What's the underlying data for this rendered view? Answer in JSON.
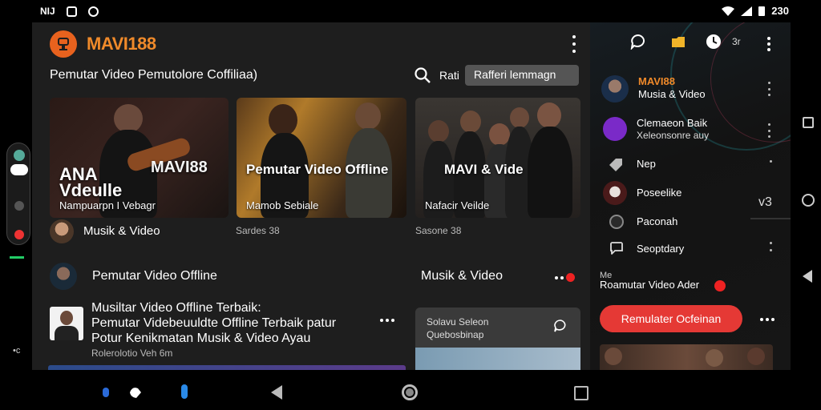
{
  "status_bar": {
    "left_text": "NIJ",
    "time": "230"
  },
  "app": {
    "brand": "MAVI188",
    "subtitle": "Pemutar Video Pemutolore Coffiliaa)",
    "search_label": "Rati",
    "search_value": "Rafferi lemmagn",
    "cards": [
      {
        "overlay": "MAVI88",
        "overlay_left": "ANA Vdeulle",
        "caption": "Nampuarpn I Vebagr"
      },
      {
        "overlay": "Pemutar Video Offline",
        "caption": "Mamob Sebiale"
      },
      {
        "overlay": "MAVI & Vide",
        "caption": "Nafacir Veilde"
      }
    ],
    "row1_title": "Musik & Video",
    "row1_meta_a": "Sardes 38",
    "row1_meta_b": "Sasone 38",
    "row2_title": "Pemutar Video Offline",
    "row2_right_title": "Musik & Video",
    "list_item": {
      "line1": "Musiltar Video Offline Terbaik:",
      "line2": "Pemutar Videbeuuldte Offline Terbaik patur",
      "line3": "Potur Kenikmatan Musik & Video Ayau",
      "meta": "Rolerolotio Veh 6m"
    },
    "feature_card": {
      "line1": "Solavu Seleon",
      "line2": "Quebosbinap"
    }
  },
  "side": {
    "clock_label": "3r",
    "items": [
      {
        "label": "MAVI88",
        "sub": "Musia & Video"
      },
      {
        "label": "Clemaeon Baik",
        "sub": "Xeleonsonre auy"
      },
      {
        "label": "Nep"
      },
      {
        "label": "Poseelike"
      },
      {
        "label": "Paconah"
      },
      {
        "label": "Seoptdary"
      }
    ],
    "section_small": "Me",
    "section_title": "Roamutar Video Ader",
    "cta_label": "Remulater Ocfeinan",
    "check": "v3"
  },
  "colors": {
    "brand_orange": "#f08a2a",
    "accent_red": "#e53935",
    "background": "#1e1e1e"
  },
  "icons": {
    "status_left": [
      "app-icon",
      "shield-icon",
      "refresh-icon"
    ],
    "status_right": [
      "wifi-icon",
      "signal-icon",
      "battery-icon"
    ],
    "side_top": [
      "chat-icon",
      "folder-icon",
      "clock-icon"
    ]
  }
}
